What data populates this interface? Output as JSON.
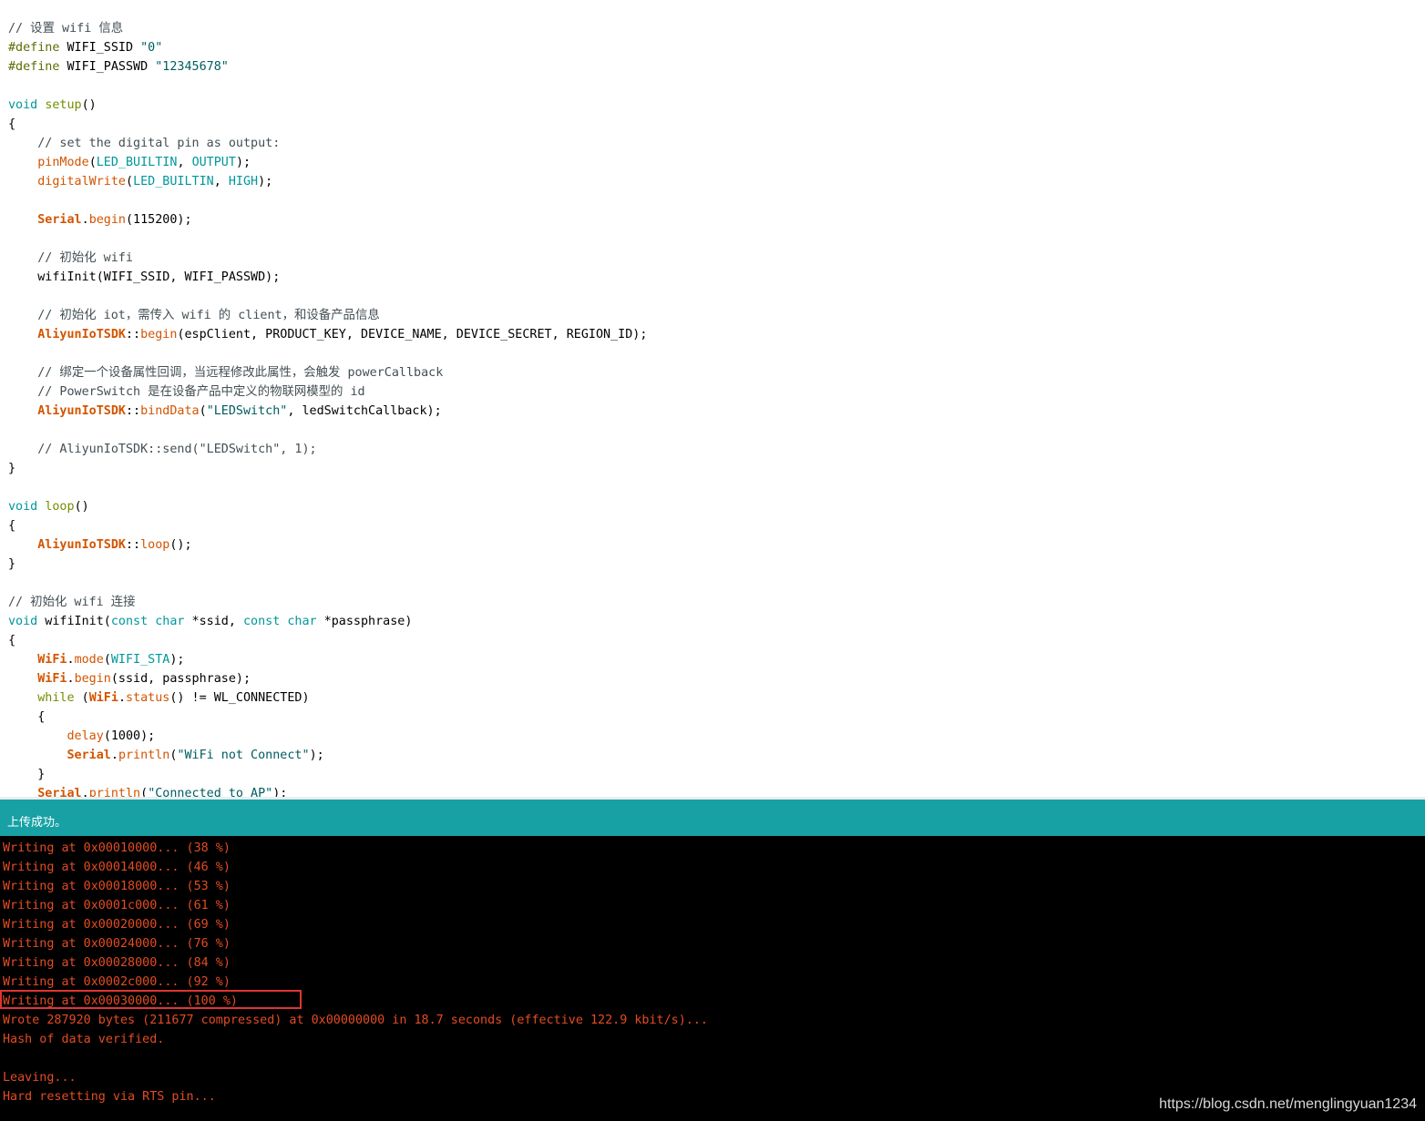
{
  "colors": {
    "status_bar": "#17a1a5",
    "console_bg": "#000000",
    "console_text": "#e34c22",
    "highlight_border": "#e03434"
  },
  "code_lines": [
    [
      {
        "t": "// 设置 wifi 信息",
        "c": "comment"
      }
    ],
    [
      {
        "t": "#define",
        "c": "pre"
      },
      {
        "t": " WIFI_SSID ",
        "c": "plain"
      },
      {
        "t": "\"0\"",
        "c": "string"
      }
    ],
    [
      {
        "t": "#define",
        "c": "pre"
      },
      {
        "t": " WIFI_PASSWD ",
        "c": "plain"
      },
      {
        "t": "\"12345678\"",
        "c": "string"
      }
    ],
    [],
    [
      {
        "t": "void",
        "c": "type"
      },
      {
        "t": " ",
        "c": "plain"
      },
      {
        "t": "setup",
        "c": "kw"
      },
      {
        "t": "()",
        "c": "plain"
      }
    ],
    [
      {
        "t": "{",
        "c": "plain"
      }
    ],
    [
      {
        "t": "    // set the digital pin as output:",
        "c": "comment"
      }
    ],
    [
      {
        "t": "    ",
        "c": "plain"
      },
      {
        "t": "pinMode",
        "c": "func"
      },
      {
        "t": "(",
        "c": "plain"
      },
      {
        "t": "LED_BUILTIN",
        "c": "const"
      },
      {
        "t": ", ",
        "c": "plain"
      },
      {
        "t": "OUTPUT",
        "c": "const"
      },
      {
        "t": ");",
        "c": "plain"
      }
    ],
    [
      {
        "t": "    ",
        "c": "plain"
      },
      {
        "t": "digitalWrite",
        "c": "func"
      },
      {
        "t": "(",
        "c": "plain"
      },
      {
        "t": "LED_BUILTIN",
        "c": "const"
      },
      {
        "t": ", ",
        "c": "plain"
      },
      {
        "t": "HIGH",
        "c": "const"
      },
      {
        "t": ");",
        "c": "plain"
      }
    ],
    [],
    [
      {
        "t": "    ",
        "c": "plain"
      },
      {
        "t": "Serial",
        "c": "class"
      },
      {
        "t": ".",
        "c": "plain"
      },
      {
        "t": "begin",
        "c": "func"
      },
      {
        "t": "(115200);",
        "c": "plain"
      }
    ],
    [],
    [
      {
        "t": "    // 初始化 wifi",
        "c": "comment"
      }
    ],
    [
      {
        "t": "    wifiInit(WIFI_SSID, WIFI_PASSWD);",
        "c": "plain"
      }
    ],
    [],
    [
      {
        "t": "    // 初始化 iot，需传入 wifi 的 client，和设备产品信息",
        "c": "comment"
      }
    ],
    [
      {
        "t": "    ",
        "c": "plain"
      },
      {
        "t": "AliyunIoTSDK",
        "c": "class"
      },
      {
        "t": "::",
        "c": "plain"
      },
      {
        "t": "begin",
        "c": "func"
      },
      {
        "t": "(espClient, PRODUCT_KEY, DEVICE_NAME, DEVICE_SECRET, REGION_ID);",
        "c": "plain"
      }
    ],
    [],
    [
      {
        "t": "    // 绑定一个设备属性回调，当远程修改此属性，会触发 powerCallback",
        "c": "comment"
      }
    ],
    [
      {
        "t": "    // PowerSwitch 是在设备产品中定义的物联网模型的 id",
        "c": "comment"
      }
    ],
    [
      {
        "t": "    ",
        "c": "plain"
      },
      {
        "t": "AliyunIoTSDK",
        "c": "class"
      },
      {
        "t": "::",
        "c": "plain"
      },
      {
        "t": "bindData",
        "c": "func"
      },
      {
        "t": "(",
        "c": "plain"
      },
      {
        "t": "\"LEDSwitch\"",
        "c": "string"
      },
      {
        "t": ", ledSwitchCallback);",
        "c": "plain"
      }
    ],
    [],
    [
      {
        "t": "    // AliyunIoTSDK::send(\"LEDSwitch\", 1);",
        "c": "comment"
      }
    ],
    [
      {
        "t": "}",
        "c": "plain"
      }
    ],
    [],
    [
      {
        "t": "void",
        "c": "type"
      },
      {
        "t": " ",
        "c": "plain"
      },
      {
        "t": "loop",
        "c": "kw"
      },
      {
        "t": "()",
        "c": "plain"
      }
    ],
    [
      {
        "t": "{",
        "c": "plain"
      }
    ],
    [
      {
        "t": "    ",
        "c": "plain"
      },
      {
        "t": "AliyunIoTSDK",
        "c": "class"
      },
      {
        "t": "::",
        "c": "plain"
      },
      {
        "t": "loop",
        "c": "func"
      },
      {
        "t": "();",
        "c": "plain"
      }
    ],
    [
      {
        "t": "}",
        "c": "plain"
      }
    ],
    [],
    [
      {
        "t": "// 初始化 wifi 连接",
        "c": "comment"
      }
    ],
    [
      {
        "t": "void",
        "c": "type"
      },
      {
        "t": " wifiInit(",
        "c": "plain"
      },
      {
        "t": "const",
        "c": "type"
      },
      {
        "t": " ",
        "c": "plain"
      },
      {
        "t": "char",
        "c": "type"
      },
      {
        "t": " *ssid, ",
        "c": "plain"
      },
      {
        "t": "const",
        "c": "type"
      },
      {
        "t": " ",
        "c": "plain"
      },
      {
        "t": "char",
        "c": "type"
      },
      {
        "t": " *passphrase)",
        "c": "plain"
      }
    ],
    [
      {
        "t": "{",
        "c": "plain"
      }
    ],
    [
      {
        "t": "    ",
        "c": "plain"
      },
      {
        "t": "WiFi",
        "c": "class"
      },
      {
        "t": ".",
        "c": "plain"
      },
      {
        "t": "mode",
        "c": "func"
      },
      {
        "t": "(",
        "c": "plain"
      },
      {
        "t": "WIFI_STA",
        "c": "const"
      },
      {
        "t": ");",
        "c": "plain"
      }
    ],
    [
      {
        "t": "    ",
        "c": "plain"
      },
      {
        "t": "WiFi",
        "c": "class"
      },
      {
        "t": ".",
        "c": "plain"
      },
      {
        "t": "begin",
        "c": "func"
      },
      {
        "t": "(ssid, passphrase);",
        "c": "plain"
      }
    ],
    [
      {
        "t": "    ",
        "c": "plain"
      },
      {
        "t": "while",
        "c": "kw"
      },
      {
        "t": " (",
        "c": "plain"
      },
      {
        "t": "WiFi",
        "c": "class"
      },
      {
        "t": ".",
        "c": "plain"
      },
      {
        "t": "status",
        "c": "func"
      },
      {
        "t": "() != WL_CONNECTED)",
        "c": "plain"
      }
    ],
    [
      {
        "t": "    {",
        "c": "plain"
      }
    ],
    [
      {
        "t": "        ",
        "c": "plain"
      },
      {
        "t": "delay",
        "c": "func"
      },
      {
        "t": "(1000);",
        "c": "plain"
      }
    ],
    [
      {
        "t": "        ",
        "c": "plain"
      },
      {
        "t": "Serial",
        "c": "class"
      },
      {
        "t": ".",
        "c": "plain"
      },
      {
        "t": "println",
        "c": "func"
      },
      {
        "t": "(",
        "c": "plain"
      },
      {
        "t": "\"WiFi not Connect\"",
        "c": "string"
      },
      {
        "t": ");",
        "c": "plain"
      }
    ],
    [
      {
        "t": "    }",
        "c": "plain"
      }
    ],
    [
      {
        "t": "    ",
        "c": "plain"
      },
      {
        "t": "Serial",
        "c": "class"
      },
      {
        "t": ".",
        "c": "plain"
      },
      {
        "t": "println",
        "c": "func"
      },
      {
        "t": "(",
        "c": "plain"
      },
      {
        "t": "\"Connected to AP\"",
        "c": "string"
      },
      {
        "t": ");",
        "c": "plain"
      }
    ]
  ],
  "status": {
    "message": "上传成功。"
  },
  "console": {
    "lines": [
      "Writing at 0x00010000... (38 %)",
      "Writing at 0x00014000... (46 %)",
      "Writing at 0x00018000... (53 %)",
      "Writing at 0x0001c000... (61 %)",
      "Writing at 0x00020000... (69 %)",
      "Writing at 0x00024000... (76 %)",
      "Writing at 0x00028000... (84 %)",
      "Writing at 0x0002c000... (92 %)",
      "Writing at 0x00030000... (100 %)",
      "Wrote 287920 bytes (211677 compressed) at 0x00000000 in 18.7 seconds (effective 122.9 kbit/s)...",
      "Hash of data verified.",
      "",
      "Leaving...",
      "Hard resetting via RTS pin..."
    ],
    "highlighted_line_index": 8
  },
  "watermark": "https://blog.csdn.net/menglingyuan1234"
}
